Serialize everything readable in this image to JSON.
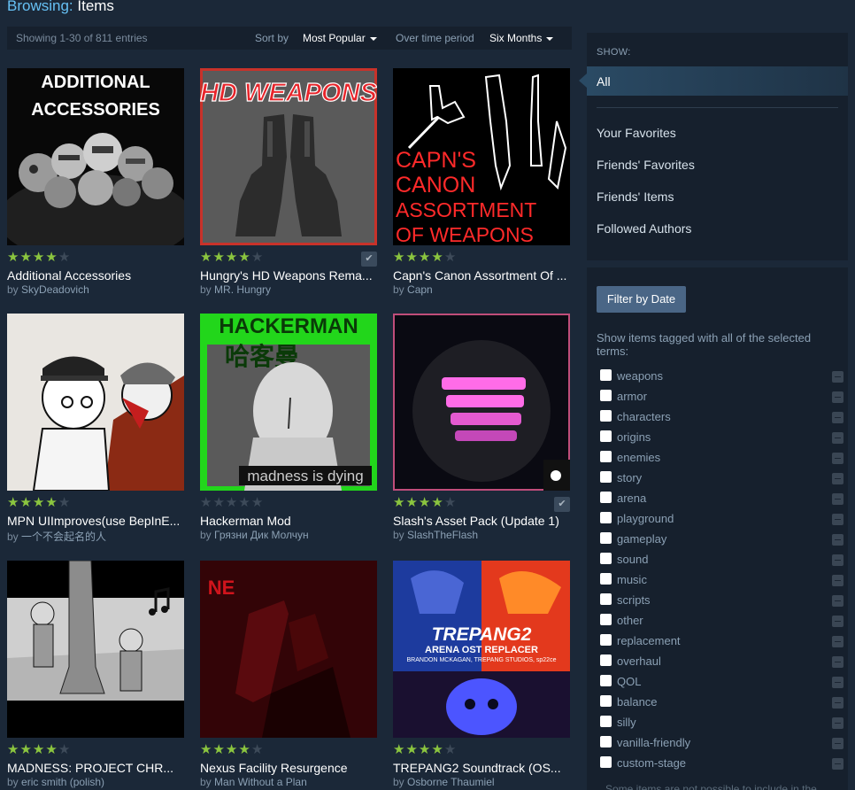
{
  "header": {
    "browsing_label": "Browsing:",
    "browsing_value": "Items"
  },
  "sortbar": {
    "count_text": "Showing 1-30 of 811 entries",
    "sort_label": "Sort by",
    "sort_value": "Most Popular",
    "period_label": "Over time period",
    "period_value": "Six Months"
  },
  "items": [
    {
      "title": "Additional Accessories",
      "by": "by",
      "author": "SkyDeadovich",
      "rating": 4
    },
    {
      "title": "Hungry's HD Weapons Rema...",
      "by": "by",
      "author": "MR. Hungry",
      "rating": 4
    },
    {
      "title": "Capn's Canon Assortment Of ...",
      "by": "by",
      "author": "Capn",
      "rating": 4
    },
    {
      "title": "MPN UIImproves(use BepInE...",
      "by": "by",
      "author": "一个不会起名的人",
      "rating": 4
    },
    {
      "title": "Hackerman Mod",
      "by": "by",
      "author": "Грязни Дик Молчун",
      "rating": 0
    },
    {
      "title": "Slash's Asset Pack (Update 1)",
      "by": "by",
      "author": "SlashTheFlash",
      "rating": 4
    },
    {
      "title": "MADNESS: PROJECT CHR...",
      "by": "by",
      "author": "eric smith (polish)",
      "rating": 4
    },
    {
      "title": "Nexus Facility Resurgence",
      "by": "by",
      "author": "Man Without a Plan",
      "rating": 4
    },
    {
      "title": "TREPANG2 Soundtrack (OS...",
      "by": "by",
      "author": "Osborne Thaumiel",
      "rating": 4
    }
  ],
  "thumb_text": {
    "additional_1": "ADDITIONAL",
    "additional_2": "ACCESSORIES",
    "hd": "HD WEAPONS",
    "capn_1": "CAPN'S",
    "capn_2": "CANON",
    "capn_3": "ASSORTMENT",
    "capn_4": "OF WEAPONS",
    "hack_1": "HACKERMAN",
    "hack_2": "哈客曼",
    "hack_3": "madness is dying",
    "trep_1": "TREPANG2",
    "trep_2": "ARENA OST REPLACER",
    "trep_3": "BRANDON MCKAGAN, TREPANG STUDIOS, sp22ce"
  },
  "colors": {
    "accent": "#66c0f4",
    "star_on": "#8bc53f",
    "background": "#1b2838",
    "panel": "#16202d"
  },
  "show_panel": {
    "heading": "SHOW:",
    "selected": "All",
    "links": [
      "Your Favorites",
      "Friends' Favorites",
      "Friends' Items",
      "Followed Authors"
    ]
  },
  "filter_panel": {
    "button": "Filter by Date",
    "description": "Show items tagged with all of the selected terms:",
    "tags": [
      "weapons",
      "armor",
      "characters",
      "origins",
      "enemies",
      "story",
      "arena",
      "playground",
      "gameplay",
      "sound",
      "music",
      "scripts",
      "other",
      "replacement",
      "overhaul",
      "QOL",
      "balance",
      "silly",
      "vanilla-friendly",
      "custom-stage"
    ],
    "footnote": "Some items are not possible to include in the"
  }
}
